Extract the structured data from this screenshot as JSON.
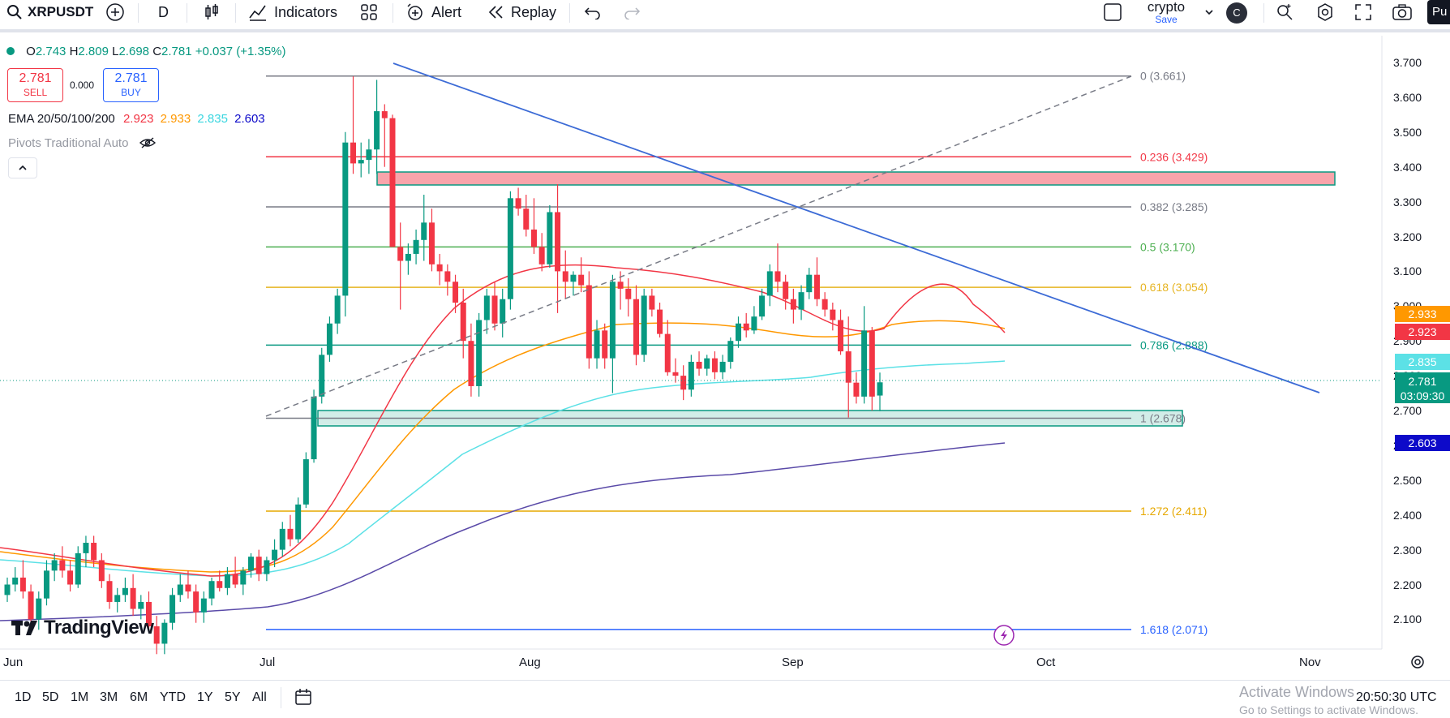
{
  "toolbar": {
    "symbol": "XRPUSDT",
    "interval": "D",
    "indicators": "Indicators",
    "alert": "Alert",
    "replay": "Replay",
    "layout_name": "crypto",
    "layout_sub": "Save",
    "avatar_letter": "C",
    "publish": "Pu"
  },
  "legend": {
    "open_label": "O",
    "open": "2.743",
    "high_label": "H",
    "high": "2.809",
    "low_label": "L",
    "low": "2.698",
    "close_label": "C",
    "close": "2.781",
    "change": "+0.037 (+1.35%)",
    "sell_price": "2.781",
    "sell_label": "SELL",
    "spread": "0.000",
    "buy_price": "2.781",
    "buy_label": "BUY",
    "ema_label": "EMA 20/50/100/200",
    "ema20": "2.923",
    "ema50": "2.933",
    "ema100": "2.835",
    "ema200": "2.603",
    "pivots_label": "Pivots Traditional Auto"
  },
  "y_axis": [
    "3.700",
    "3.600",
    "3.500",
    "3.400",
    "3.300",
    "3.200",
    "3.100",
    "3.000",
    "2.900",
    "2.800",
    "2.700",
    "2.600",
    "2.500",
    "2.400",
    "2.300",
    "2.200",
    "2.100"
  ],
  "x_axis": [
    "Jun",
    "Jul",
    "Aug",
    "Sep",
    "Oct",
    "Nov"
  ],
  "fib_levels": [
    {
      "label": "0 (3.661)",
      "price": 3.661,
      "color": "#787b86"
    },
    {
      "label": "0.236 (3.429)",
      "price": 3.429,
      "color": "#f23645"
    },
    {
      "label": "0.382 (3.285)",
      "price": 3.285,
      "color": "#787b86"
    },
    {
      "label": "0.5 (3.170)",
      "price": 3.17,
      "color": "#4caf50"
    },
    {
      "label": "0.618 (3.054)",
      "price": 3.054,
      "color": "#e6b422"
    },
    {
      "label": "0.786 (2.888)",
      "price": 2.888,
      "color": "#089981"
    },
    {
      "label": "1 (2.678)",
      "price": 2.678,
      "color": "#787b86"
    },
    {
      "label": "1.272 (2.411)",
      "price": 2.411,
      "color": "#e6a800"
    },
    {
      "label": "1.618 (2.071)",
      "price": 2.071,
      "color": "#2962ff"
    }
  ],
  "price_labels": {
    "ema50": {
      "text": "2.933",
      "color": "#ff9800"
    },
    "ema20": {
      "text": "2.923",
      "color": "#f23645"
    },
    "ema100": {
      "text": "2.835",
      "color": "#5ce1e6"
    },
    "last_price": "2.781",
    "countdown": "03:09:30",
    "ema200": {
      "text": "2.603",
      "color": "#0d0ac9"
    }
  },
  "ranges": [
    "1D",
    "5D",
    "1M",
    "3M",
    "6M",
    "YTD",
    "1Y",
    "5Y",
    "All"
  ],
  "clock": "20:50:30 UTC",
  "watermark": {
    "line1": "Activate Windows",
    "line2": "Go to Settings to activate Windows."
  },
  "logo_text": "TradingView",
  "colors": {
    "up": "#089981",
    "down": "#f23645",
    "trend": "#3c6bd6"
  }
}
